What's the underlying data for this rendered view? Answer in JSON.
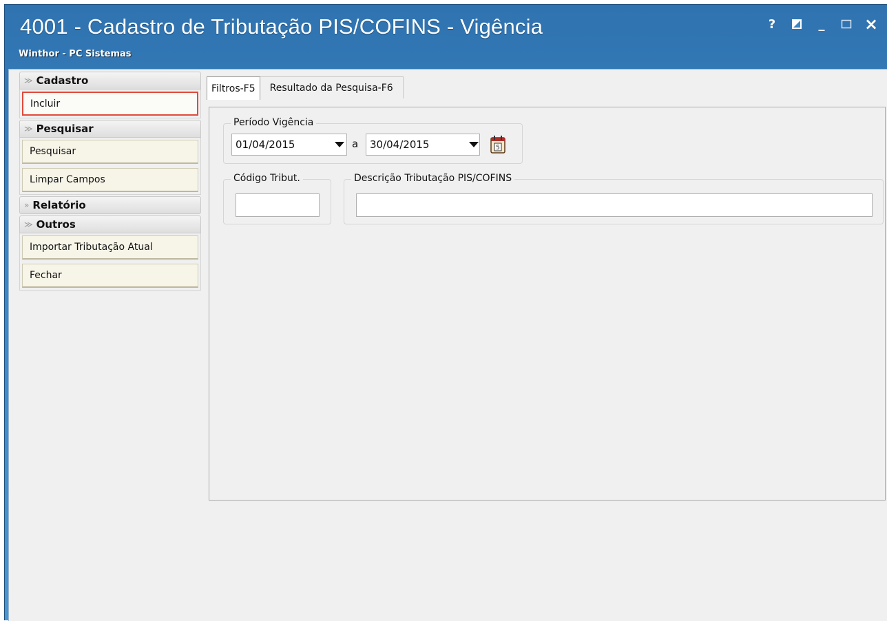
{
  "window": {
    "title": "4001 - Cadastro de Tributação PIS/COFINS - Vigência",
    "subtitle": "Winthor - PC Sistemas",
    "buttons": {
      "help": "?",
      "minimize": "_",
      "close": "×"
    }
  },
  "sidebar": {
    "groups": [
      {
        "label": "Cadastro",
        "expanded": true,
        "items": [
          "Incluir"
        ]
      },
      {
        "label": "Pesquisar",
        "expanded": true,
        "items": [
          "Pesquisar",
          "Limpar Campos"
        ]
      },
      {
        "label": "Relatório",
        "expanded": false,
        "items": []
      },
      {
        "label": "Outros",
        "expanded": true,
        "items": [
          "Importar Tributação Atual",
          "Fechar"
        ]
      }
    ]
  },
  "tabs": [
    {
      "label": "Filtros-F5",
      "active": true
    },
    {
      "label": "Resultado da Pesquisa-F6",
      "active": false
    }
  ],
  "filters": {
    "periodo": {
      "label": "Período Vigência",
      "start": "01/04/2015",
      "separator": "a",
      "end": "30/04/2015",
      "calendar_icon": "calendar-icon"
    },
    "codigo": {
      "label": "Código Tribut.",
      "value": ""
    },
    "descricao": {
      "label": "Descrição Tributação PIS/COFINS",
      "value": ""
    }
  },
  "colors": {
    "titlebar": "#3a86c4",
    "selected_border": "#e04a3a",
    "client_bg": "#f0f0f0"
  }
}
